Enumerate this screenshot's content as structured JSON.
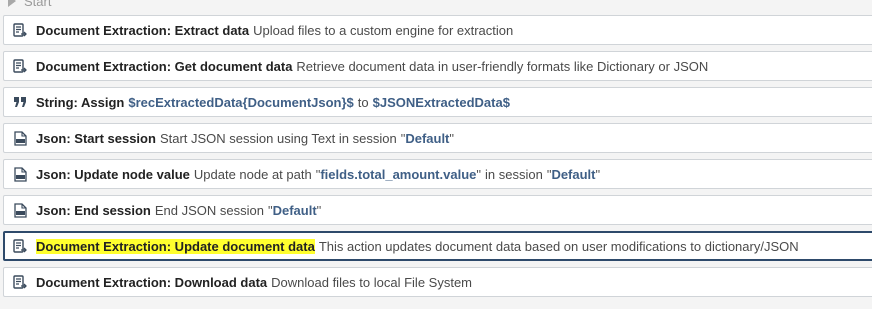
{
  "start": {
    "label": "Start",
    "icon": "play-triangle-icon"
  },
  "rows": [
    {
      "icon": "document-export-icon",
      "title": "Document Extraction: Extract data",
      "desc": "Upload files to a custom engine for extraction"
    },
    {
      "icon": "document-export-icon",
      "title": "Document Extraction: Get document data",
      "desc": "Retrieve document data in user-friendly formats like Dictionary or JSON"
    },
    {
      "icon": "quote-icon",
      "title": "String: Assign",
      "var1": "$recExtractedData{DocumentJson}$",
      "to": "to",
      "var2": "$JSONExtractedData$"
    },
    {
      "icon": "json-file-icon",
      "title": "Json: Start session",
      "desc": "Start JSON session using Text in session",
      "q1": "\"",
      "session": "Default",
      "q2": "\""
    },
    {
      "icon": "json-file-icon",
      "title": "Json: Update node value",
      "desc": "Update node at path",
      "q1": "\"",
      "path": "fields.total_amount.value",
      "q2": "\"",
      "mid": "in session",
      "q3": "\"",
      "session": "Default",
      "q4": "\""
    },
    {
      "icon": "json-file-icon",
      "title": "Json: End session",
      "desc": "End JSON session",
      "q1": "\"",
      "session": "Default",
      "q2": "\""
    },
    {
      "icon": "document-export-icon",
      "title": "Document Extraction: Update document data",
      "desc": "This action updates document data based on user modifications to dictionary/JSON",
      "selected": true,
      "highlight_color": "#ffff2e"
    },
    {
      "icon": "document-export-icon",
      "title": "Document Extraction: Download data",
      "desc": "Download files to local File System"
    }
  ],
  "colors": {
    "variable": "#3f5f86",
    "selected_border": "#2e4a6b",
    "highlight": "#ffff2e"
  }
}
